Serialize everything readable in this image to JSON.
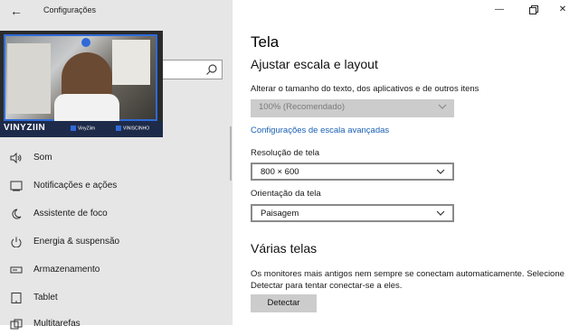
{
  "window": {
    "app_title": "Configurações",
    "back_icon": "back-arrow-icon",
    "controls": [
      "minimize-icon",
      "maximize-icon",
      "close-icon"
    ]
  },
  "sidebar": {
    "search_icon": "search-icon",
    "webcam": {
      "name": "VINYZIIN",
      "tag1": "VinyZiim",
      "tag2": "VINISCINHO"
    },
    "items": [
      {
        "label": "Som",
        "icon": "speaker-icon"
      },
      {
        "label": "Notificações e ações",
        "icon": "notification-icon"
      },
      {
        "label": "Assistente de foco",
        "icon": "moon-icon"
      },
      {
        "label": "Energia & suspensão",
        "icon": "power-icon"
      },
      {
        "label": "Armazenamento",
        "icon": "storage-icon"
      },
      {
        "label": "Tablet",
        "icon": "tablet-icon"
      },
      {
        "label": "Multitarefas",
        "icon": "multitask-icon"
      }
    ]
  },
  "main": {
    "title": "Tela",
    "scale_heading": "Ajustar escala e layout",
    "scale_label": "Alterar o tamanho do texto, dos aplicativos e de outros itens",
    "scale_value": "100% (Recomendado)",
    "advanced_link": "Configurações de escala avançadas",
    "resolution_label": "Resolução de tela",
    "resolution_value": "800 × 600",
    "orientation_label": "Orientação da tela",
    "orientation_value": "Paisagem",
    "multi_heading": "Várias telas",
    "multi_text": "Os monitores mais antigos nem sempre se conectam automaticamente. Selecione Detectar para tentar conectar-se a eles.",
    "detect_button": "Detectar"
  },
  "colors": {
    "sidebar_bg": "#e6e6e6",
    "link": "#1a5fb4",
    "webcam_accent": "#2f6ad8"
  }
}
